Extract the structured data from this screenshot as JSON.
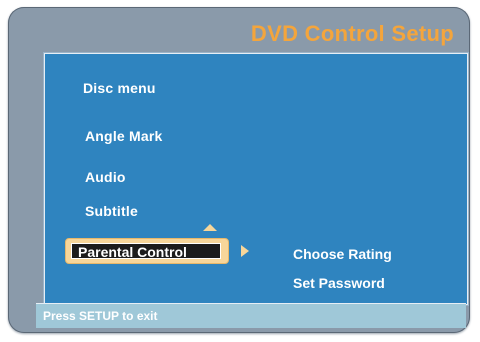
{
  "header": {
    "title": "DVD Control Setup"
  },
  "menu": {
    "items": [
      {
        "label": "Disc menu"
      },
      {
        "label": "Angle Mark"
      },
      {
        "label": "Audio"
      },
      {
        "label": "Subtitle"
      },
      {
        "label": "Parental Control"
      }
    ]
  },
  "submenu": {
    "items": [
      {
        "label": "Choose Rating"
      },
      {
        "label": "Set Password"
      }
    ]
  },
  "status": {
    "text": "Press SETUP to exit"
  },
  "colors": {
    "accent_orange": "#f4a53c",
    "panel_blue": "#2f84bf",
    "selection_bg": "#f7d69a",
    "status_bg": "#9fc8d8",
    "frame_gray": "#8a9aaa"
  },
  "icons": {
    "up_arrow": "up-arrow-icon",
    "right_arrow": "right-arrow-icon"
  }
}
